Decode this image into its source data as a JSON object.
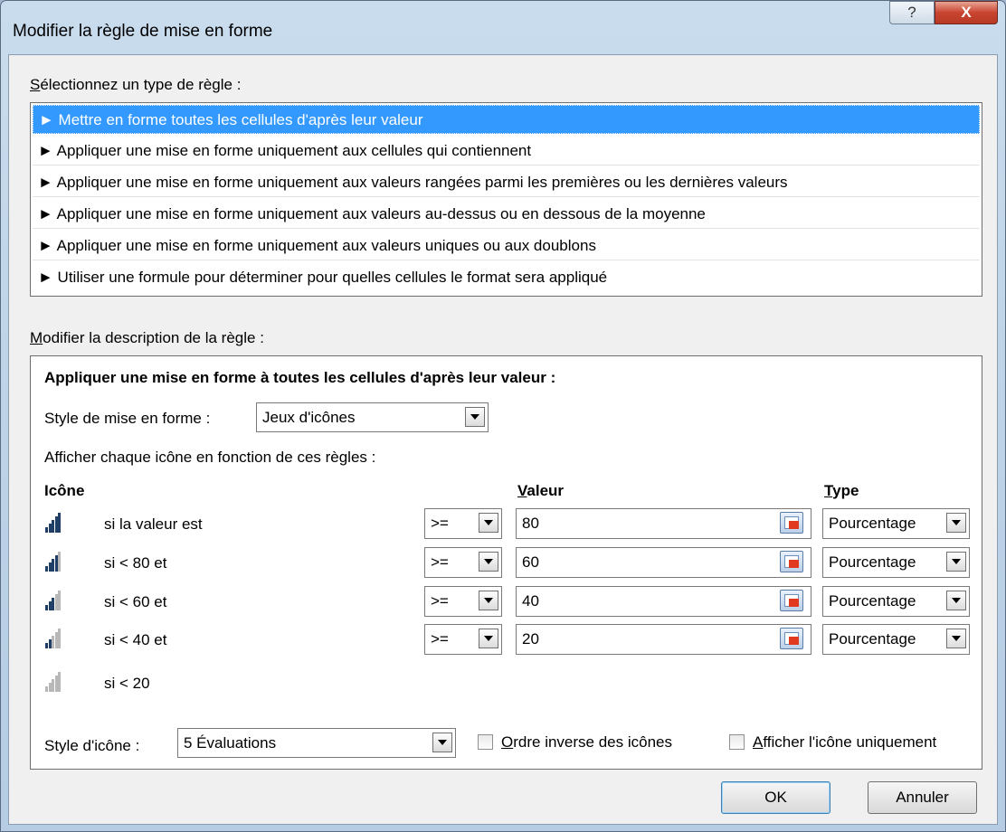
{
  "window": {
    "title": "Modifier la règle de mise en forme",
    "help": "?",
    "close": "X"
  },
  "rule_type": {
    "label": "Sélectionnez un type de règle :",
    "items": [
      "► Mettre en forme toutes les cellules d'après leur valeur",
      "► Appliquer une mise en forme uniquement aux cellules qui contiennent",
      "► Appliquer une mise en forme uniquement aux valeurs rangées parmi les premières ou les dernières valeurs",
      "► Appliquer une mise en forme uniquement aux valeurs au-dessus ou en dessous de la moyenne",
      "► Appliquer une mise en forme uniquement aux valeurs uniques ou aux doublons",
      "► Utiliser une formule pour déterminer pour quelles cellules le format sera appliqué"
    ],
    "selected_index": 0
  },
  "description": {
    "label": "Modifier la description de la règle :",
    "heading": "Appliquer une mise en forme à toutes les cellules d'après leur valeur :",
    "style_label": "Style de mise en forme :",
    "style_value": "Jeux d'icônes",
    "rules_caption": "Afficher chaque icône en fonction de ces règles :",
    "col_icon": "Icône",
    "col_value": "Valeur",
    "col_type": "Type",
    "rows": [
      {
        "condition": "si la valeur est",
        "operator": ">=",
        "value": "80",
        "type": "Pourcentage",
        "bars": 5
      },
      {
        "condition": "si < 80 et",
        "operator": ">=",
        "value": "60",
        "type": "Pourcentage",
        "bars": 4
      },
      {
        "condition": "si < 60 et",
        "operator": ">=",
        "value": "40",
        "type": "Pourcentage",
        "bars": 3
      },
      {
        "condition": "si < 40 et",
        "operator": ">=",
        "value": "20",
        "type": "Pourcentage",
        "bars": 2
      },
      {
        "condition": "si < 20",
        "bars": 0
      }
    ],
    "icon_style_label": "Style d'icône :",
    "icon_style_value": "5 Évaluations",
    "reverse_label": "Ordre inverse des icônes",
    "reverse_checked": false,
    "icon_only_label": "Afficher l'icône uniquement",
    "icon_only_checked": false
  },
  "buttons": {
    "ok": "OK",
    "cancel": "Annuler"
  },
  "colors": {
    "selection": "#3399ff",
    "bar_active": "#1f3f66",
    "bar_inactive": "#b8b8b8",
    "close": "#c9442f"
  }
}
